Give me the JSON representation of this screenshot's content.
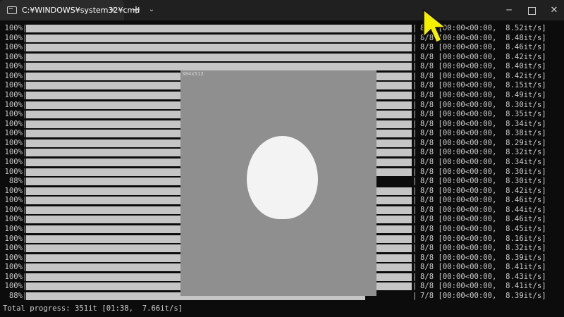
{
  "titlebar": {
    "tab_title": "C:¥WINDOWS¥system32¥cmd",
    "tab_close": "×",
    "new_tab": "+",
    "dropdown": "⌄",
    "minimize": "─",
    "close": "✕"
  },
  "overlay": {
    "label": "384x512"
  },
  "rows": [
    {
      "percent": "100%",
      "progress": 1.0,
      "info": "8/8 [00:00<00:00,  8.52it/s]"
    },
    {
      "percent": "100%",
      "progress": 1.0,
      "info": "8/8 [00:00<00:00,  8.48it/s]"
    },
    {
      "percent": "100%",
      "progress": 1.0,
      "info": "8/8 [00:00<00:00,  8.46it/s]"
    },
    {
      "percent": "100%",
      "progress": 1.0,
      "info": "8/8 [00:00<00:00,  8.42it/s]"
    },
    {
      "percent": "100%",
      "progress": 1.0,
      "info": "8/8 [00:00<00:00,  8.40it/s]"
    },
    {
      "percent": "100%",
      "progress": 1.0,
      "info": "8/8 [00:00<00:00,  8.42it/s]"
    },
    {
      "percent": "100%",
      "progress": 1.0,
      "info": "8/8 [00:00<00:00,  8.15it/s]"
    },
    {
      "percent": "100%",
      "progress": 1.0,
      "info": "8/8 [00:00<00:00,  8.49it/s]"
    },
    {
      "percent": "100%",
      "progress": 1.0,
      "info": "8/8 [00:00<00:00,  8.30it/s]"
    },
    {
      "percent": "100%",
      "progress": 1.0,
      "info": "8/8 [00:00<00:00,  8.35it/s]"
    },
    {
      "percent": "100%",
      "progress": 1.0,
      "info": "8/8 [00:00<00:00,  8.34it/s]"
    },
    {
      "percent": "100%",
      "progress": 1.0,
      "info": "8/8 [00:00<00:00,  8.38it/s]"
    },
    {
      "percent": "100%",
      "progress": 1.0,
      "info": "8/8 [00:00<00:00,  8.29it/s]"
    },
    {
      "percent": "100%",
      "progress": 1.0,
      "info": "8/8 [00:00<00:00,  8.32it/s]"
    },
    {
      "percent": "100%",
      "progress": 1.0,
      "info": "8/8 [00:00<00:00,  8.34it/s]"
    },
    {
      "percent": "100%",
      "progress": 1.0,
      "info": "8/8 [00:00<00:00,  8.30it/s]"
    },
    {
      "percent": "88%",
      "progress": 0.88,
      "info": "8/8 [00:00<00:00,  8.30it/s]"
    },
    {
      "percent": "100%",
      "progress": 1.0,
      "info": "8/8 [00:00<00:00,  8.42it/s]"
    },
    {
      "percent": "100%",
      "progress": 1.0,
      "info": "8/8 [00:00<00:00,  8.46it/s]"
    },
    {
      "percent": "100%",
      "progress": 1.0,
      "info": "8/8 [00:00<00:00,  8.44it/s]"
    },
    {
      "percent": "100%",
      "progress": 1.0,
      "info": "8/8 [00:00<00:00,  8.46it/s]"
    },
    {
      "percent": "100%",
      "progress": 1.0,
      "info": "8/8 [00:00<00:00,  8.45it/s]"
    },
    {
      "percent": "100%",
      "progress": 1.0,
      "info": "8/8 [00:00<00:00,  8.16it/s]"
    },
    {
      "percent": "100%",
      "progress": 1.0,
      "info": "8/8 [00:00<00:00,  8.32it/s]"
    },
    {
      "percent": "100%",
      "progress": 1.0,
      "info": "8/8 [00:00<00:00,  8.39it/s]"
    },
    {
      "percent": "100%",
      "progress": 1.0,
      "info": "8/8 [00:00<00:00,  8.41it/s]"
    },
    {
      "percent": "100%",
      "progress": 1.0,
      "info": "8/8 [00:00<00:00,  8.43it/s]"
    },
    {
      "percent": "100%",
      "progress": 1.0,
      "info": "8/8 [00:00<00:00,  8.41it/s]"
    },
    {
      "percent": "88%",
      "progress": 0.88,
      "info": "7/8 [00:00<00:00,  8.39it/s]"
    }
  ],
  "total_progress": "Total progress: 351it [01:38,  7.66it/s]",
  "colors": {
    "background": "#0c0c0c",
    "text": "#cccccc",
    "bar": "#d6d6d6",
    "cursor": "#f5f000"
  },
  "icons": {
    "terminal": "terminal-icon",
    "pointer": "mouse-pointer-icon"
  }
}
